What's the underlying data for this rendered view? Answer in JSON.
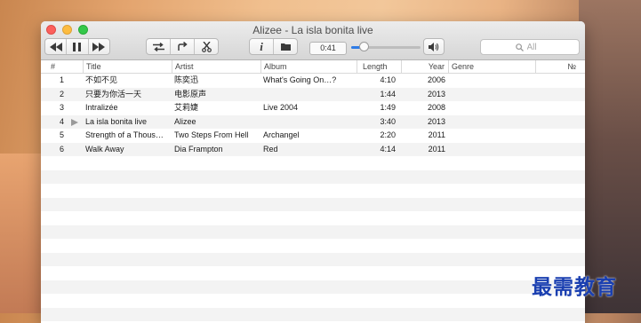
{
  "window": {
    "title": "Alizee - La isla bonita live"
  },
  "toolbar": {
    "buttons": [
      {
        "name": "previous-button",
        "icon": "rewind-icon"
      },
      {
        "name": "pause-button",
        "icon": "pause-icon"
      },
      {
        "name": "next-button",
        "icon": "fast-forward-icon"
      },
      {
        "name": "shuffle-button",
        "icon": "shuffle-icon"
      },
      {
        "name": "repeat-button",
        "icon": "repeat-icon"
      },
      {
        "name": "scissors-button",
        "icon": "scissors-icon"
      },
      {
        "name": "info-button",
        "icon": "info-icon"
      },
      {
        "name": "folder-button",
        "icon": "folder-icon"
      }
    ],
    "time": "0:41",
    "progress": 0.18,
    "volume_icon": "volume-icon",
    "search_placeholder": "All"
  },
  "table": {
    "columns": [
      "#",
      "Title",
      "Artist",
      "Album",
      "Length",
      "Year",
      "Genre",
      "№"
    ],
    "playing_row": 3,
    "rows": [
      {
        "num": "1",
        "title": "不如不见",
        "artist": "陈奕迅",
        "album": "What's Going On…?",
        "length": "4:10",
        "year": "2006",
        "genre": ""
      },
      {
        "num": "2",
        "title": "只要为你活一天",
        "artist": "电影原声",
        "album": "",
        "length": "1:44",
        "year": "2013",
        "genre": ""
      },
      {
        "num": "3",
        "title": "Intralizée",
        "artist": "艾莉婕",
        "album": "Live 2004",
        "length": "1:49",
        "year": "2008",
        "genre": ""
      },
      {
        "num": "4",
        "title": "La isla bonita live",
        "artist": "Alizee",
        "album": "",
        "length": "3:40",
        "year": "2013",
        "genre": ""
      },
      {
        "num": "5",
        "title": "Strength of a Thous…",
        "artist": "Two Steps From Hell",
        "album": "Archangel",
        "length": "2:20",
        "year": "2011",
        "genre": ""
      },
      {
        "num": "6",
        "title": "Walk Away",
        "artist": "Dia Frampton",
        "album": "Red",
        "length": "4:14",
        "year": "2011",
        "genre": ""
      }
    ]
  },
  "watermark": "最需教育",
  "colors": {
    "accent": "#2e7be6",
    "stripe": "#f3f3f3",
    "watermark": "#1a3fb0"
  }
}
